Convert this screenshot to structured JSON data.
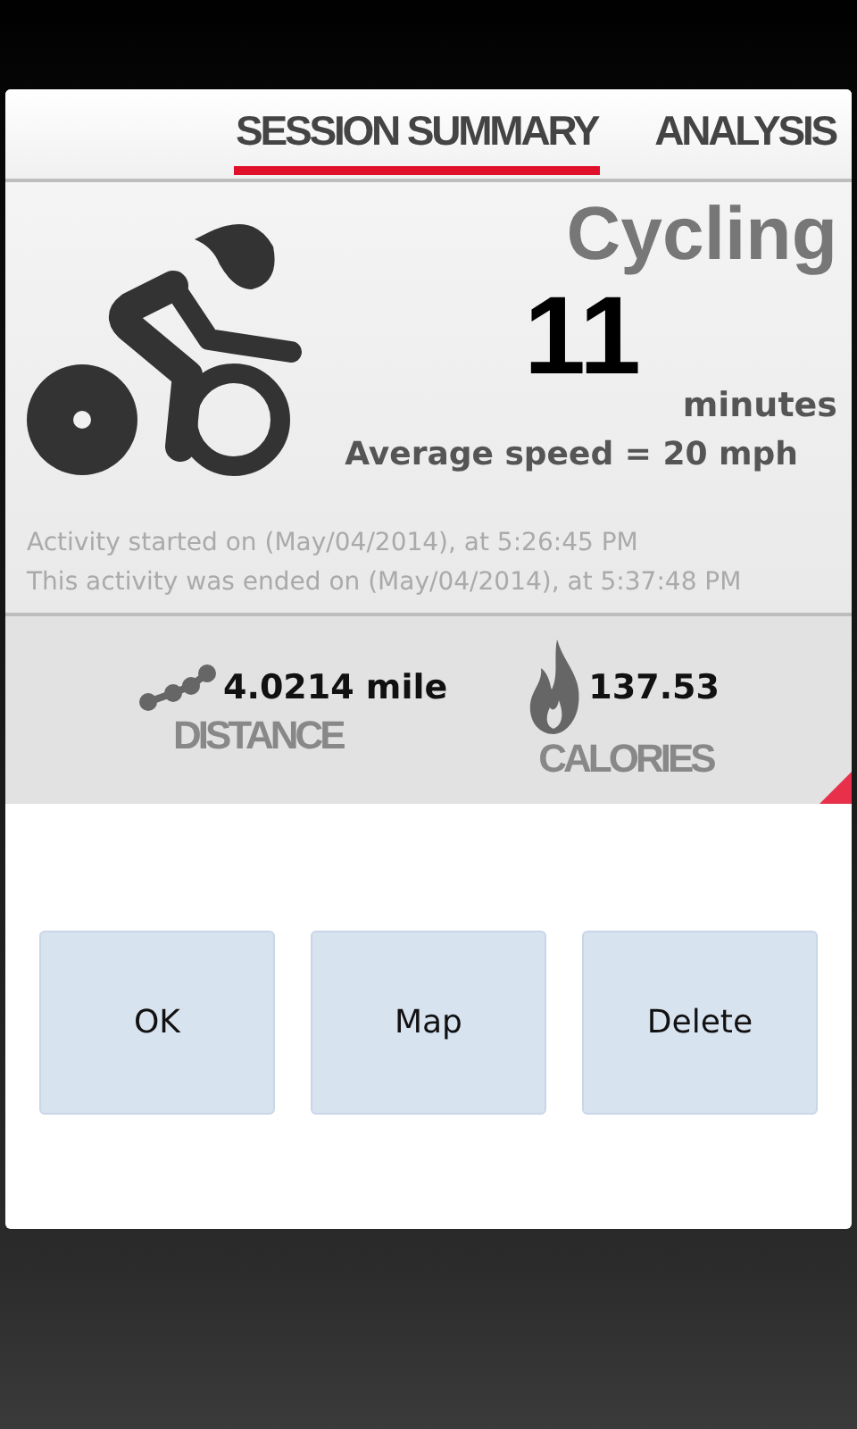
{
  "tabs": [
    {
      "label": "SESSION SUMMARY",
      "selected": true
    },
    {
      "label": "ANALYSIS",
      "selected": false
    }
  ],
  "summary": {
    "activity": "Cycling",
    "duration": "11",
    "unit": "minutes",
    "speed": "Average speed = 20 mph",
    "started": "Activity started on (May/04/2014), at 5:26:45 PM",
    "ended": "This activity was ended on (May/04/2014), at 5:37:48 PM"
  },
  "stats": [
    {
      "kind": "distance",
      "value": "4.0214 mile",
      "label": "DISTANCE"
    },
    {
      "kind": "calories",
      "value": "137.53",
      "label": "CALORIES"
    }
  ],
  "buttons": [
    "OK",
    "Map",
    "Delete"
  ]
}
